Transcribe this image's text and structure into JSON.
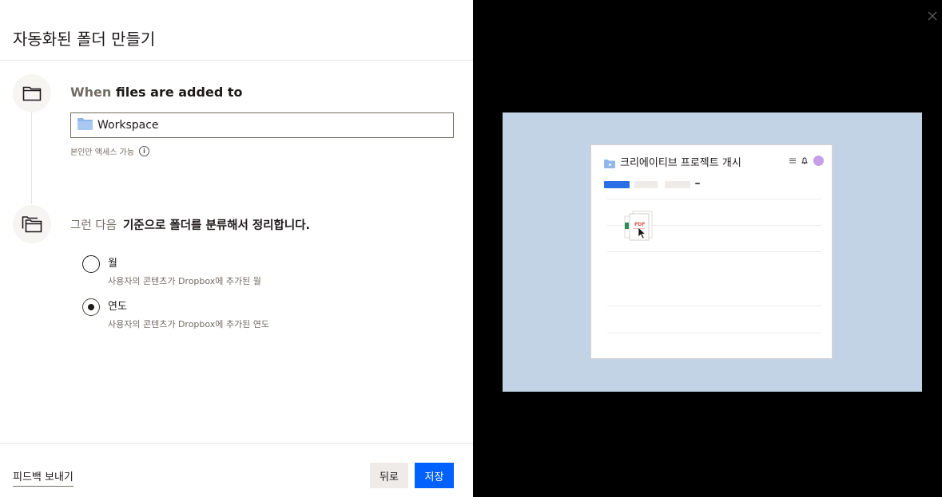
{
  "dialog": {
    "title": "자동화된 폴더 만들기",
    "step1": {
      "title_prefix": "When",
      "title_rest": "files are added to",
      "folder_value": "Workspace",
      "access_note": "본인만 액세스 가능"
    },
    "step2": {
      "title_prefix": "그런 다음",
      "title_rest": "기준으로 폴더를 분류해서 정리합니다."
    },
    "options": [
      {
        "label": "월",
        "description": "사용자의 콘텐츠가 Dropbox에 추가된 월",
        "selected": false
      },
      {
        "label": "연도",
        "description": "사용자의 콘텐츠가 Dropbox에 추가된 연도",
        "selected": true
      }
    ],
    "footer": {
      "feedback_label": "피드백 보내기",
      "back_label": "뒤로",
      "save_label": "저장"
    }
  },
  "preview": {
    "card_title": "크리에이티브 프로젝트 개시",
    "file_badge": "PDF",
    "background_color": "#c2d3e6",
    "accent_color": "#0061fe"
  }
}
